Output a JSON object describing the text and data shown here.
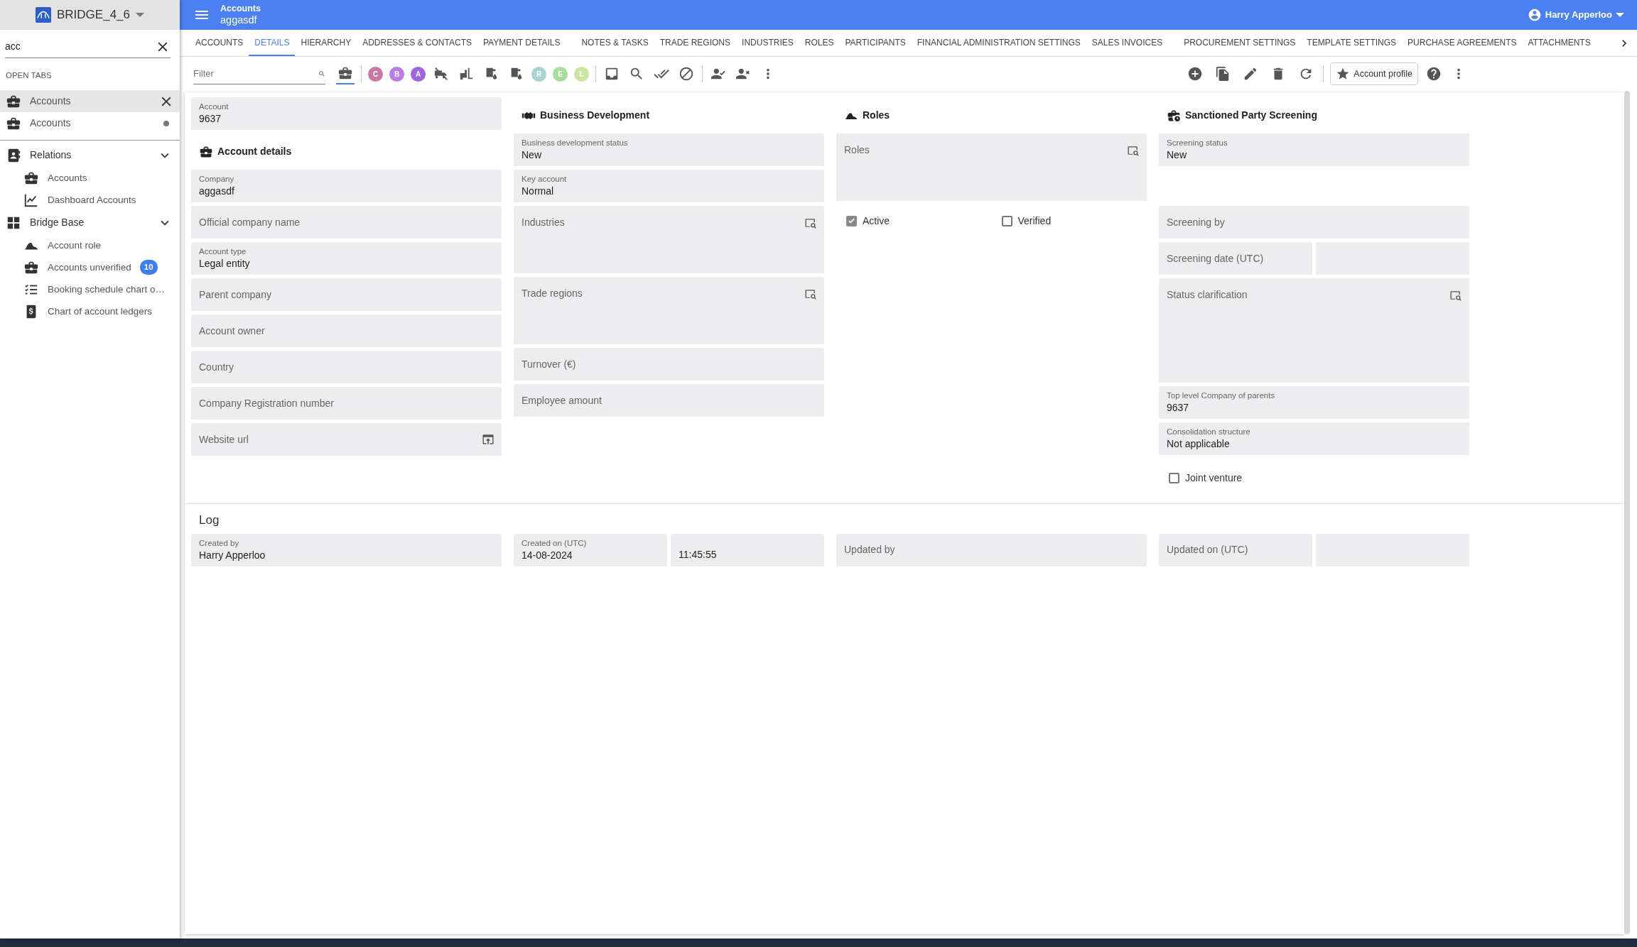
{
  "sidebar": {
    "app_title": "BRIDGE_4_6",
    "search": {
      "value": "acc"
    },
    "open_tabs_heading": "OPEN TABS",
    "open_tabs": [
      {
        "label": "Accounts",
        "selected": true,
        "unsaved": false
      },
      {
        "label": "Accounts",
        "selected": false,
        "unsaved": true
      }
    ],
    "groups": [
      {
        "label": "Relations",
        "kind": "contacts",
        "expanded": true,
        "items": [
          {
            "label": "Accounts",
            "kind": "briefcase"
          },
          {
            "label": "Dashboard Accounts",
            "kind": "chart"
          }
        ]
      },
      {
        "label": "Bridge Base",
        "kind": "grid",
        "expanded": true,
        "items": [
          {
            "label": "Account role",
            "kind": "hat"
          },
          {
            "label": "Accounts unverified",
            "kind": "briefcase",
            "badge": "10"
          },
          {
            "label": "Booking schedule chart o…",
            "kind": "checklist"
          },
          {
            "label": "Chart of account ledgers",
            "kind": "ledger"
          }
        ]
      }
    ]
  },
  "header": {
    "title": "Accounts",
    "subtitle": "aggasdf",
    "user": "Harry Apperloo"
  },
  "tabs": [
    {
      "label": "ACCOUNTS",
      "selected": false
    },
    {
      "label": "DETAILS",
      "selected": true
    },
    {
      "label": "HIERARCHY",
      "selected": false
    },
    {
      "label": "ADDRESSES & CONTACTS",
      "selected": false
    },
    {
      "label": "PAYMENT DETAILS",
      "selected": false
    },
    {
      "label": "NOTES & TASKS",
      "selected": false
    },
    {
      "label": "TRADE REGIONS",
      "selected": false
    },
    {
      "label": "INDUSTRIES",
      "selected": false
    },
    {
      "label": "ROLES",
      "selected": false
    },
    {
      "label": "PARTICIPANTS",
      "selected": false
    },
    {
      "label": "FINANCIAL ADMINISTRATION SETTINGS",
      "selected": false
    },
    {
      "label": "SALES INVOICES",
      "selected": false
    },
    {
      "label": "PROCUREMENT SETTINGS",
      "selected": false
    },
    {
      "label": "TEMPLATE SETTINGS",
      "selected": false
    },
    {
      "label": "PURCHASE AGREEMENTS",
      "selected": false
    },
    {
      "label": "ATTACHMENTS",
      "selected": false
    }
  ],
  "toolbar": {
    "filter": {
      "placeholder": "Filter"
    },
    "briefcase_selected": true,
    "letter_badges": [
      {
        "letter": "C",
        "color": "#c878a8"
      },
      {
        "letter": "B",
        "color": "#bc7ae6"
      },
      {
        "letter": "A",
        "color": "#9d66e0"
      },
      {
        "letter": "R",
        "color": "#a9d3cf"
      },
      {
        "letter": "E",
        "color": "#a8dd9b"
      },
      {
        "letter": "L",
        "color": "#c8e6a0"
      }
    ],
    "profile_button": "Account profile"
  },
  "columns": [
    [
      {
        "kind": "field",
        "label": "Account",
        "value": "9637"
      },
      {
        "kind": "heading",
        "label": "Account details"
      },
      {
        "kind": "field",
        "label": "Company",
        "value": "aggasdf"
      },
      {
        "kind": "field",
        "label": "Official company name"
      },
      {
        "kind": "field",
        "label": "Account type",
        "value": "Legal entity"
      },
      {
        "kind": "field",
        "label": "Parent company"
      },
      {
        "kind": "field",
        "label": "Account owner"
      },
      {
        "kind": "field",
        "label": "Country"
      },
      {
        "kind": "field",
        "label": "Company Registration number"
      },
      {
        "kind": "link",
        "label": "Website url"
      }
    ],
    [
      {
        "kind": "heading",
        "label": "Business Development"
      },
      {
        "kind": "field",
        "label": "Business development status",
        "value": "New"
      },
      {
        "kind": "field",
        "label": "Key account",
        "value": "Normal"
      },
      {
        "kind": "lookup",
        "label": "Industries"
      },
      {
        "kind": "lookup",
        "label": "Trade regions"
      },
      {
        "kind": "field",
        "label": "Turnover (€)"
      },
      {
        "kind": "field",
        "label": "Employee amount"
      }
    ],
    [
      {
        "kind": "heading",
        "label": "Roles"
      },
      {
        "kind": "lookup",
        "label": "Roles"
      },
      {
        "kind": "checkboxes",
        "items": [
          {
            "label": "Active",
            "checked": true
          },
          {
            "label": "Verified",
            "checked": false
          }
        ]
      }
    ],
    [
      {
        "kind": "heading",
        "label": "Sanctioned Party Screening"
      },
      {
        "kind": "field",
        "label": "Screening status",
        "value": "New"
      },
      {
        "kind": "field",
        "label": "Screening by"
      },
      {
        "kind": "pair",
        "label": "Screening date (UTC)"
      },
      {
        "kind": "memo",
        "label": "Status clarification"
      },
      {
        "kind": "field",
        "label": "Top level Company of parents",
        "value": "9637"
      },
      {
        "kind": "field",
        "label": "Consolidation structure",
        "value": "Not applicable"
      },
      {
        "kind": "checkboxes",
        "items": [
          {
            "label": "Joint venture",
            "checked": false
          }
        ]
      }
    ]
  ],
  "log": {
    "title": "Log",
    "fields": [
      {
        "kind": "field",
        "label": "Created by",
        "value": "Harry Apperloo"
      },
      {
        "kind": "pair",
        "label": "Created on (UTC)",
        "value": "14-08-2024",
        "value2": "11:45:55"
      },
      {
        "kind": "field",
        "label": "Updated by"
      },
      {
        "kind": "pair",
        "label": "Updated on (UTC)"
      }
    ]
  }
}
